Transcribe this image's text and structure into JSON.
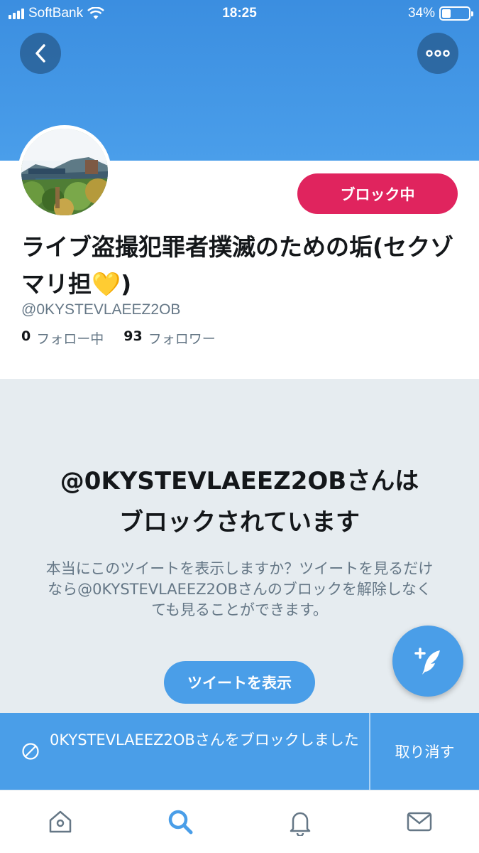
{
  "status_bar": {
    "carrier": "SoftBank",
    "time": "18:25",
    "battery": "34%",
    "battery_level": 0.34
  },
  "header": {
    "back_icon": "chevron-left-icon",
    "more_icon": "more-dots-icon"
  },
  "profile": {
    "block_button_label": "ブロック中",
    "display_name": "ライブ盗撮犯罪者撲滅のための垢(セクゾ マリ担",
    "name_emoji": "💛",
    "name_suffix": ")",
    "handle": "@0KYSTEVLAEEZ2OB",
    "following_count": "0",
    "following_label": "フォロー中",
    "followers_count": "93",
    "followers_label": "フォロワー"
  },
  "blocked": {
    "title_line1": "@0KYSTEVLAEEZ2OBさんは",
    "title_line2": "ブロックされています",
    "description": "本当にこのツイートを表示しますか？ツイートを見るだけなら@0KYSTEVLAEEZ2OBさんのブロックを解除しなくても見ることができます。",
    "show_button_label": "ツイートを表示"
  },
  "snackbar": {
    "message": "0KYSTEVLAEEZ2OBさんをブロックしました",
    "undo_label": "取り消す"
  },
  "tabbar": {
    "items": [
      "home-icon",
      "search-icon",
      "notifications-icon",
      "messages-icon"
    ],
    "active": "search-icon"
  },
  "colors": {
    "brand_blue": "#4a9ee8",
    "block_red": "#e0245e",
    "panel_gray": "#e6ecf0"
  }
}
